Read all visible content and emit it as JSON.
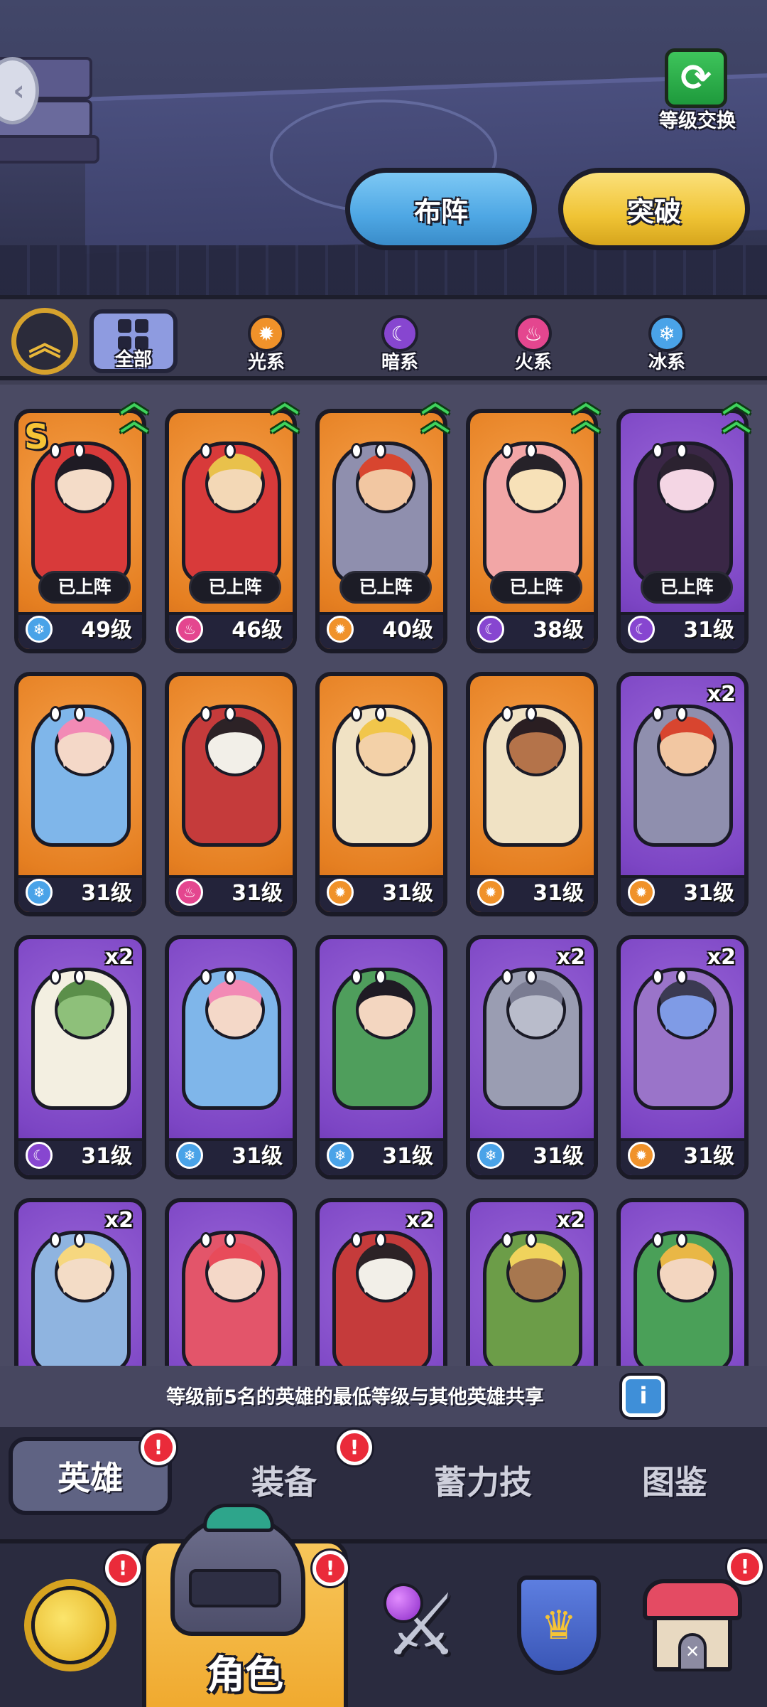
{
  "header": {
    "level_swap_label": "等级交换",
    "formation_label": "布阵",
    "breakthrough_label": "突破"
  },
  "filters": {
    "all_label": "全部",
    "items": [
      {
        "label": "光系",
        "icon": "light-element-icon",
        "color": "#f0922a",
        "glyph": "✹"
      },
      {
        "label": "暗系",
        "icon": "dark-element-icon",
        "color": "#8746d0",
        "glyph": "☾"
      },
      {
        "label": "火系",
        "icon": "fire-element-icon",
        "color": "#e4468f",
        "glyph": "♨"
      },
      {
        "label": "冰系",
        "icon": "ice-element-icon",
        "color": "#4aa3e8",
        "glyph": "❄"
      }
    ]
  },
  "heroes": [
    {
      "level": "49级",
      "element": "ice",
      "bg": "orange",
      "deployed": "已上阵",
      "rank": "S",
      "star": true,
      "upgrade": true,
      "skin": "#f4dcc8",
      "hair": "#1f1b24",
      "body": "#d83a3a"
    },
    {
      "level": "46级",
      "element": "fire",
      "bg": "orange",
      "deployed": "已上阵",
      "upgrade": true,
      "skin": "#f3d8b6",
      "hair": "#e9c14b",
      "body": "#d83a3a"
    },
    {
      "level": "40级",
      "element": "light",
      "bg": "orange",
      "deployed": "已上阵",
      "upgrade": true,
      "skin": "#f2c7a2",
      "hair": "#d8452f",
      "body": "#8f8fae"
    },
    {
      "level": "38级",
      "element": "dark",
      "bg": "orange",
      "deployed": "已上阵",
      "upgrade": true,
      "skin": "#f7e1b8",
      "hair": "#262229",
      "body": "#f2a6a6"
    },
    {
      "level": "31级",
      "element": "dark",
      "bg": "purple",
      "deployed": "已上阵",
      "upgrade": true,
      "skin": "#f4d6e4",
      "hair": "#2b2230",
      "body": "#3a2746"
    },
    {
      "level": "31级",
      "element": "ice",
      "bg": "orange",
      "skin": "#f4d8c8",
      "hair": "#f28ab5",
      "body": "#7fb6ea"
    },
    {
      "level": "31级",
      "element": "fire",
      "bg": "orange",
      "skin": "#f2efe8",
      "hair": "#2c2226",
      "body": "#c53b3b"
    },
    {
      "level": "31级",
      "element": "light",
      "bg": "orange",
      "skin": "#f3d1a8",
      "hair": "#f1c64b",
      "body": "#f0e2c4"
    },
    {
      "level": "31级",
      "element": "light",
      "bg": "orange",
      "skin": "#b4734a",
      "hair": "#2a1e22",
      "body": "#f0e2c4"
    },
    {
      "level": "31级",
      "element": "light",
      "bg": "purple",
      "dup": "x2",
      "skin": "#f2c7a2",
      "hair": "#d8452f",
      "body": "#8f8fae"
    },
    {
      "level": "31级",
      "element": "dark",
      "bg": "purple",
      "dup": "x2",
      "skin": "#8ec07a",
      "hair": "#5b8f4a",
      "body": "#f3efe1"
    },
    {
      "level": "31级",
      "element": "ice",
      "bg": "purple",
      "skin": "#f4d8c8",
      "hair": "#f28ab5",
      "body": "#7fb6ea"
    },
    {
      "level": "31级",
      "element": "ice",
      "bg": "purple",
      "skin": "#f3d6c0",
      "hair": "#1f1b24",
      "body": "#4f9e5c"
    },
    {
      "level": "31级",
      "element": "ice",
      "bg": "purple",
      "dup": "x2",
      "skin": "#b9bccb",
      "hair": "#7a7c92",
      "body": "#9a9db2"
    },
    {
      "level": "31级",
      "element": "light",
      "bg": "purple",
      "dup": "x2",
      "skin": "#7f9be6",
      "hair": "#3b3a52",
      "body": "#9a74c9"
    },
    {
      "level": "",
      "element": "none",
      "bg": "purple",
      "dup": "x2",
      "skin": "#f3dcc6",
      "hair": "#f6d77f",
      "body": "#8fb4e0"
    },
    {
      "level": "",
      "element": "none",
      "bg": "purple",
      "skin": "#f4d8c8",
      "hair": "#e84b5a",
      "body": "#e3556a"
    },
    {
      "level": "",
      "element": "none",
      "bg": "purple",
      "dup": "x2",
      "skin": "#f2efe8",
      "hair": "#2c2226",
      "body": "#c53b3b"
    },
    {
      "level": "",
      "element": "none",
      "bg": "purple",
      "dup": "x2",
      "skin": "#a7774f",
      "hair": "#f0d35c",
      "body": "#6c9d48"
    },
    {
      "level": "",
      "element": "none",
      "bg": "purple",
      "skin": "#f3d6c0",
      "hair": "#e9b746",
      "body": "#4aa058"
    }
  ],
  "info": {
    "text": "等级前5名的英雄的最低等级与其他英雄共享",
    "button": "i"
  },
  "subtabs": [
    {
      "label": "英雄",
      "active": true,
      "badge": "!"
    },
    {
      "label": "装备",
      "badge": "!"
    },
    {
      "label": "蓄力技"
    },
    {
      "label": "图鉴"
    }
  ],
  "bottom_nav": {
    "active_label": "角色",
    "badge": "!",
    "items": [
      "sun-icon",
      "helmet-icon",
      "magic-sword-icon",
      "guild-shield-icon",
      "home-icon"
    ]
  }
}
